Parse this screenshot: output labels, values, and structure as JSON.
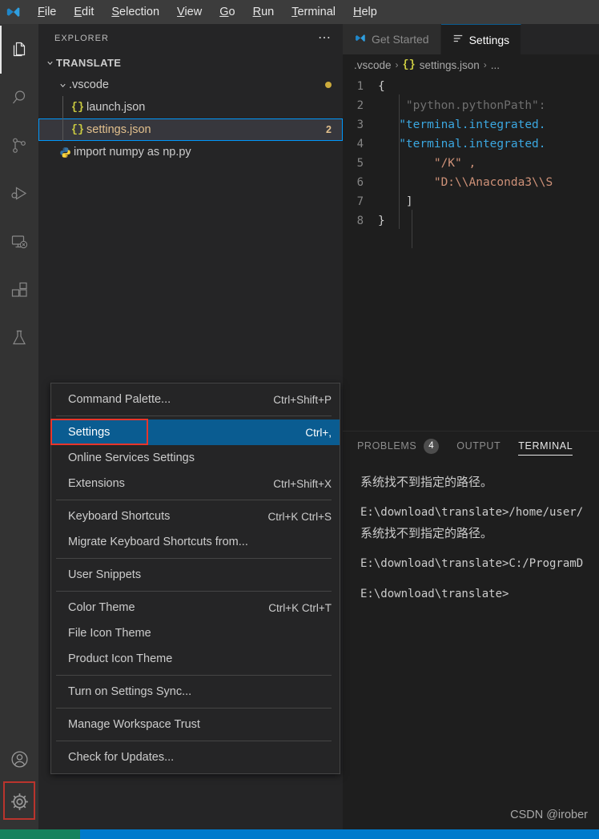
{
  "window": {
    "logo_icon": "vscode-logo-icon"
  },
  "menubar": {
    "items": [
      {
        "label": "File",
        "mnemonic": "F"
      },
      {
        "label": "Edit",
        "mnemonic": "E"
      },
      {
        "label": "Selection",
        "mnemonic": "S"
      },
      {
        "label": "View",
        "mnemonic": "V"
      },
      {
        "label": "Go",
        "mnemonic": "G"
      },
      {
        "label": "Run",
        "mnemonic": "R"
      },
      {
        "label": "Terminal",
        "mnemonic": "T"
      },
      {
        "label": "Help",
        "mnemonic": "H"
      }
    ]
  },
  "activitybar": {
    "items": [
      {
        "name": "explorer",
        "icon": "files-icon",
        "active": true
      },
      {
        "name": "search",
        "icon": "search-icon",
        "active": false
      },
      {
        "name": "source-control",
        "icon": "source-control-icon",
        "active": false
      },
      {
        "name": "run-and-debug",
        "icon": "run-debug-icon",
        "active": false
      },
      {
        "name": "remote-explorer",
        "icon": "remote-explorer-icon",
        "active": false
      },
      {
        "name": "extensions",
        "icon": "extensions-icon",
        "active": false
      },
      {
        "name": "testing",
        "icon": "beaker-icon",
        "active": false
      }
    ],
    "bottom": [
      {
        "name": "accounts",
        "icon": "account-icon"
      },
      {
        "name": "manage",
        "icon": "gear-icon",
        "annotated": true
      }
    ],
    "annotation_color": "#e8352b"
  },
  "sidebar": {
    "header_title": "EXPLORER",
    "more_actions_icon": "ellipsis-icon",
    "root": {
      "label": "TRANSLATE",
      "expanded": true
    },
    "tree": [
      {
        "label": ".vscode",
        "type": "folder",
        "expanded": true,
        "depth": 1,
        "badge_dot": true
      },
      {
        "label": "launch.json",
        "type": "json",
        "icon": "{}",
        "depth": 2
      },
      {
        "label": "settings.json",
        "type": "json",
        "icon": "{}",
        "depth": 2,
        "selected": true,
        "modified": true,
        "badge": "2"
      },
      {
        "label": "import numpy as np.py",
        "type": "python",
        "icon": "python-icon",
        "depth": 1
      }
    ]
  },
  "context_menu": {
    "groups": [
      [
        {
          "label": "Command Palette...",
          "shortcut": "Ctrl+Shift+P",
          "name": "command-palette"
        }
      ],
      [
        {
          "label": "Settings",
          "shortcut": "Ctrl+,",
          "name": "settings",
          "active": true,
          "annotated": true
        },
        {
          "label": "Online Services Settings",
          "shortcut": "",
          "name": "online-services-settings"
        },
        {
          "label": "Extensions",
          "shortcut": "Ctrl+Shift+X",
          "name": "extensions"
        }
      ],
      [
        {
          "label": "Keyboard Shortcuts",
          "shortcut": "Ctrl+K Ctrl+S",
          "name": "keyboard-shortcuts"
        },
        {
          "label": "Migrate Keyboard Shortcuts from...",
          "shortcut": "",
          "name": "migrate-keyboard-shortcuts"
        }
      ],
      [
        {
          "label": "User Snippets",
          "shortcut": "",
          "name": "user-snippets"
        }
      ],
      [
        {
          "label": "Color Theme",
          "shortcut": "Ctrl+K Ctrl+T",
          "name": "color-theme"
        },
        {
          "label": "File Icon Theme",
          "shortcut": "",
          "name": "file-icon-theme"
        },
        {
          "label": "Product Icon Theme",
          "shortcut": "",
          "name": "product-icon-theme"
        }
      ],
      [
        {
          "label": "Turn on Settings Sync...",
          "shortcut": "",
          "name": "turn-on-settings-sync"
        }
      ],
      [
        {
          "label": "Manage Workspace Trust",
          "shortcut": "",
          "name": "manage-workspace-trust"
        }
      ],
      [
        {
          "label": "Check for Updates...",
          "shortcut": "",
          "name": "check-for-updates"
        }
      ]
    ]
  },
  "editor": {
    "tabs": [
      {
        "label": "Get Started",
        "icon": "vscode-logo-icon",
        "active": false
      },
      {
        "label": "Settings",
        "icon": "settings-lines-icon",
        "active": true
      }
    ],
    "breadcrumb": {
      "folder": ".vscode",
      "file_icon": "{}",
      "file": "settings.json",
      "more": "...",
      "separator": "›"
    },
    "lines": [
      {
        "num": "1",
        "text": "{",
        "style": "punct",
        "squiggle": false
      },
      {
        "num": "2",
        "text": "    \"python.pythonPath\":",
        "style": "key-dim",
        "squiggle": false
      },
      {
        "num": "3",
        "text": "   \"terminal.integrated.",
        "style": "key",
        "squiggle": true
      },
      {
        "num": "4",
        "text": "   \"terminal.integrated.",
        "style": "key",
        "squiggle": true
      },
      {
        "num": "5",
        "text": "        \"/K\" ,",
        "style": "str",
        "squiggle": true
      },
      {
        "num": "6",
        "text": "        \"D:\\\\Anaconda3\\\\S",
        "style": "str",
        "squiggle": true
      },
      {
        "num": "7",
        "text": "    ]",
        "style": "punct",
        "squiggle": true
      },
      {
        "num": "8",
        "text": "}",
        "style": "punct",
        "squiggle": false
      }
    ]
  },
  "panel": {
    "tabs": [
      {
        "label": "PROBLEMS",
        "badge": "4",
        "active": false,
        "name": "problems"
      },
      {
        "label": "OUTPUT",
        "badge": "",
        "active": false,
        "name": "output"
      },
      {
        "label": "TERMINAL",
        "badge": "",
        "active": true,
        "name": "terminal"
      }
    ],
    "terminal_lines": [
      {
        "text": "系统找不到指定的路径。",
        "cjk": true
      },
      {
        "text": "",
        "blank": true
      },
      {
        "text": "E:\\download\\translate>/home/user/",
        "cjk": false
      },
      {
        "text": "系统找不到指定的路径。",
        "cjk": true
      },
      {
        "text": "",
        "blank": true
      },
      {
        "text": "E:\\download\\translate>C:/ProgramD",
        "cjk": false
      },
      {
        "text": "",
        "blank": true
      },
      {
        "text": "E:\\download\\translate>",
        "cjk": false
      }
    ]
  },
  "watermark": {
    "text": "CSDN @irober"
  },
  "statusbar": {
    "remote_color": "#16825d",
    "background": "#007acc"
  }
}
